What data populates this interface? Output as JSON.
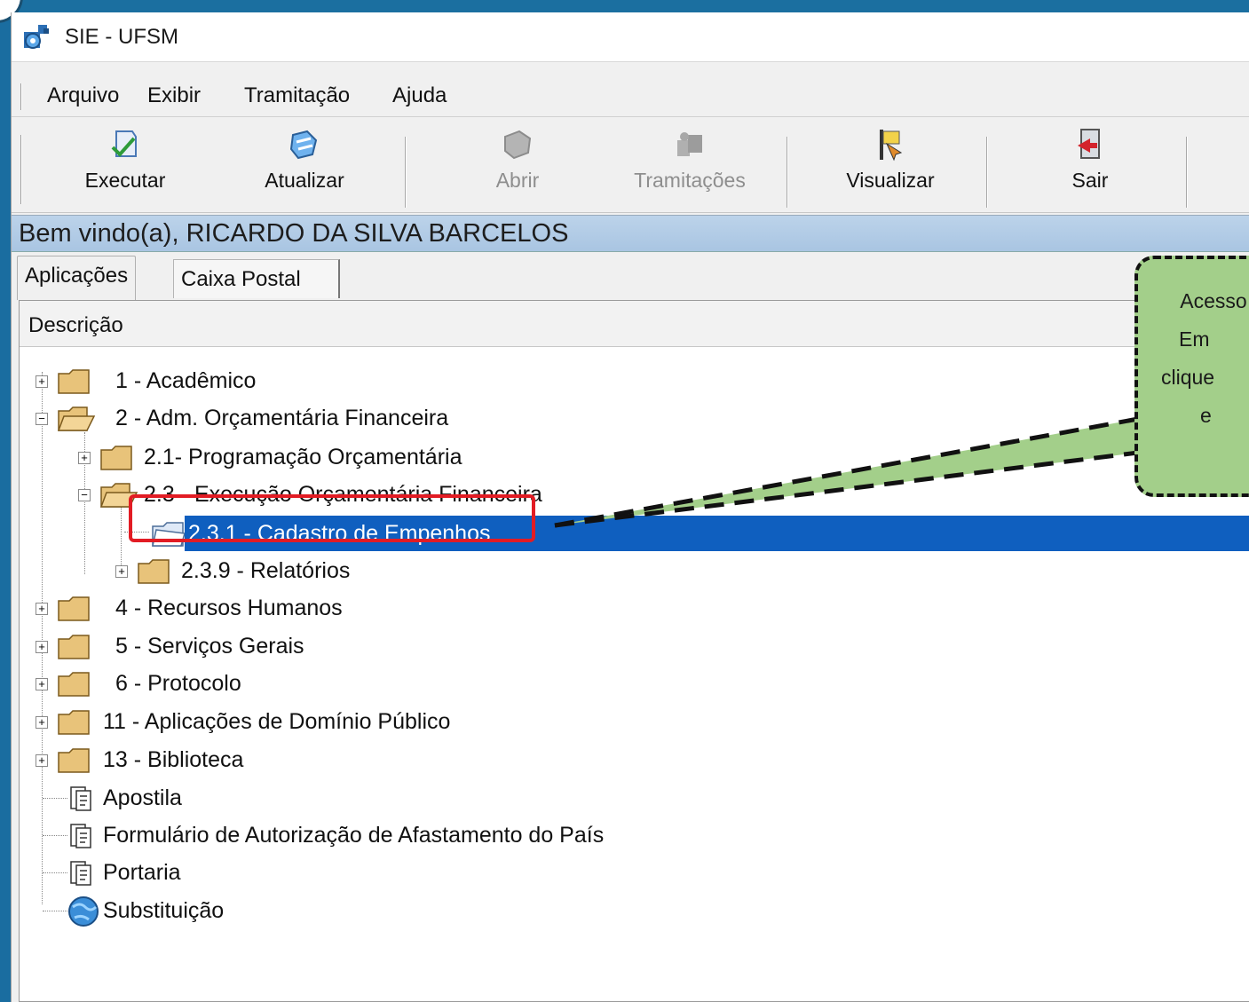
{
  "window": {
    "title": "SIE - UFSM"
  },
  "menu": [
    "Arquivo",
    "Exibir",
    "Tramitação",
    "Ajuda"
  ],
  "toolbar": {
    "executar": "Executar",
    "atualizar": "Atualizar",
    "abrir": "Abrir",
    "tramitacoes": "Tramitações",
    "visualizar": "Visualizar",
    "sair": "Sair"
  },
  "welcome": "Bem vindo(a), RICARDO DA SILVA BARCELOS",
  "tabs": [
    "Aplicações",
    "Caixa Postal"
  ],
  "column_header": "Descrição",
  "tree": [
    "1 - Acadêmico",
    "2 - Adm. Orçamentária Financeira",
    "2.1- Programação Orçamentária",
    "2.3 - Execução Orçamentária Financeira",
    "2.3.1 - Cadastro de Empenhos",
    "2.3.9 - Relatórios",
    "4 - Recursos Humanos",
    "5 - Serviços Gerais",
    "6 - Protocolo",
    "11 - Aplicações de Domínio Público",
    "13 - Biblioteca",
    "Apostila",
    "Formulário de Autorização de Afastamento do País",
    "Portaria",
    "Substituição"
  ],
  "callout": {
    "lines": [
      "Acesso",
      "Em",
      "clique",
      "e"
    ]
  },
  "colors": {
    "selection": "#0f5fbf",
    "highlight_box": "#e21c24",
    "callout_fill": "#a3cf8a",
    "welcome_bar": "#b3cce6"
  }
}
